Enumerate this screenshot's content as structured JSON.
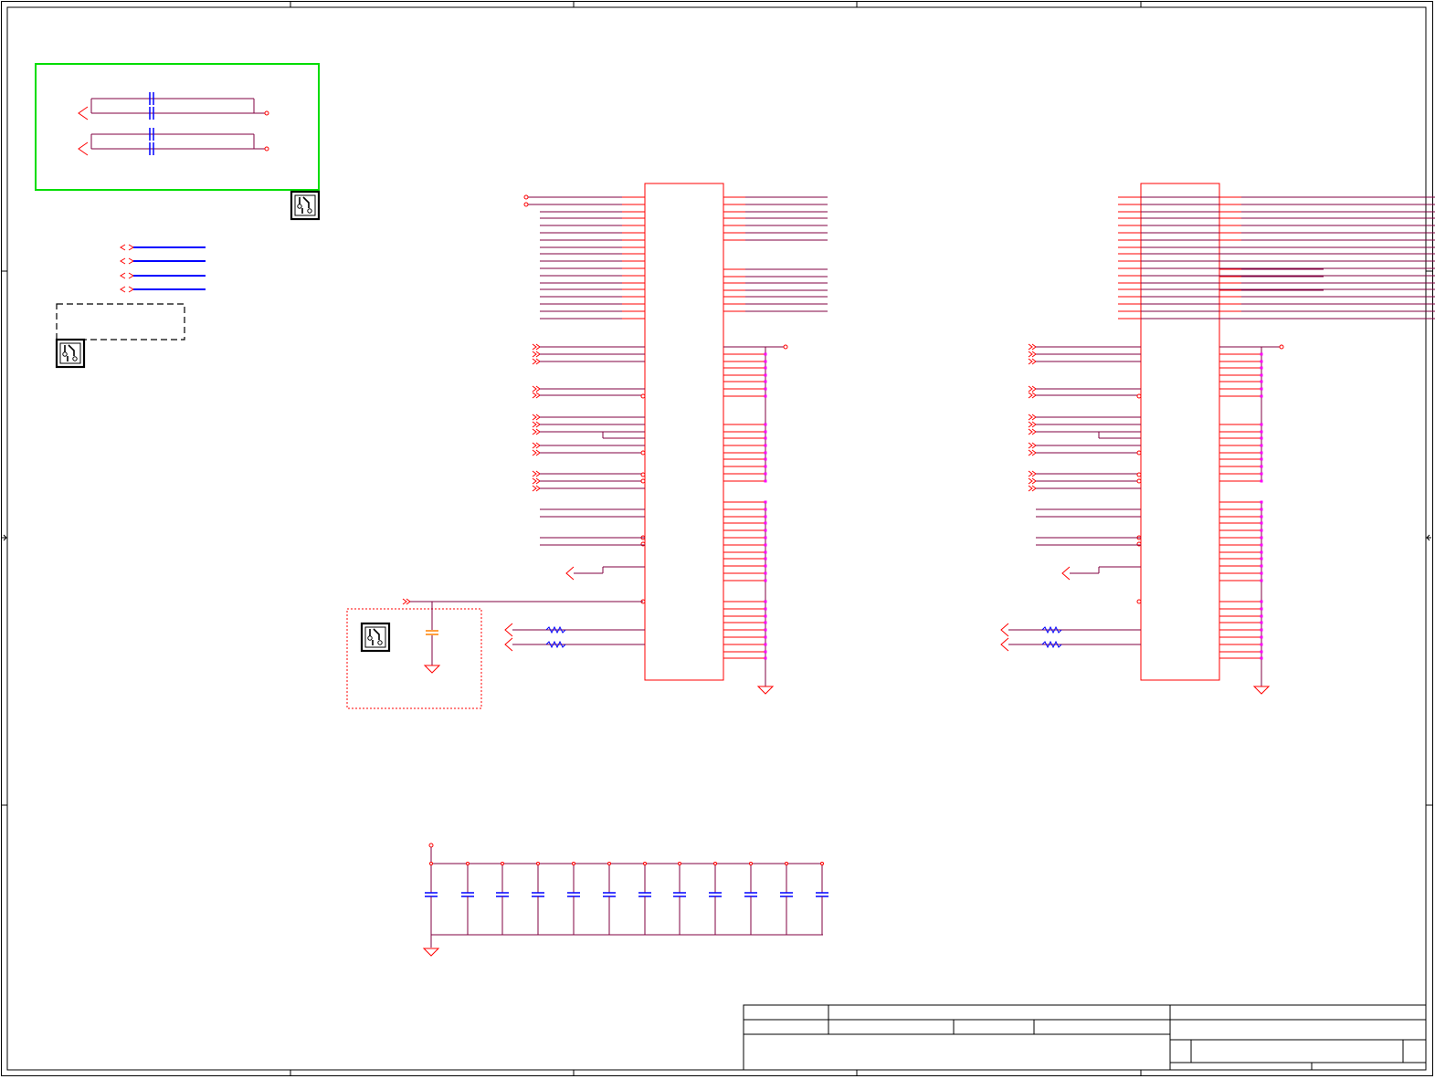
{
  "sheet": {
    "title": ""
  },
  "colors": {
    "frame": "#000000",
    "pin": "#ff0000",
    "wire": "#800040",
    "bus": "#0000ff",
    "capacitor": "#0000ff",
    "junction": "#ff00ff",
    "highlight_box": "#00dd00",
    "annotation_box": "#ff0000",
    "note_box": "#000000",
    "aux_capacitor": "#ff8000"
  },
  "icons": [
    "pcb-layout-icon",
    "pcb-layout-icon",
    "pcb-layout-icon"
  ],
  "title_block": {
    "labels": []
  }
}
